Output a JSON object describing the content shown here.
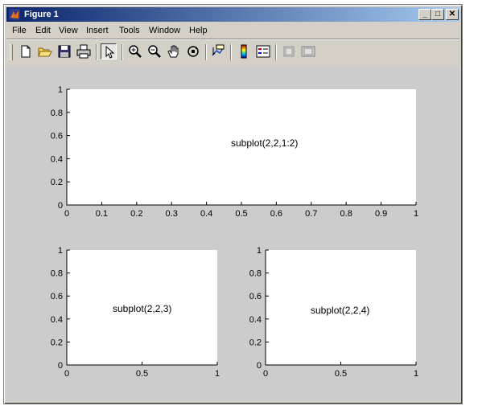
{
  "window": {
    "title": "Figure 1"
  },
  "title_buttons": {
    "minimize": "_",
    "maximize": "□",
    "close": "✕"
  },
  "menu": [
    "File",
    "Edit",
    "View",
    "Insert",
    "Tools",
    "Window",
    "Help"
  ],
  "toolbar": {
    "buttons": [
      "new-file",
      "open-folder",
      "save",
      "print",
      "select-arrow",
      "zoom-in",
      "zoom-out",
      "pan-hand",
      "rotate-3d",
      "data-cursor",
      "colorbar",
      "legend",
      "hide-plot-tools",
      "show-plot-tools"
    ]
  },
  "axes": [
    {
      "label": "subplot(2,2,1:2)",
      "xticks": [
        "0",
        "0.1",
        "0.2",
        "0.3",
        "0.4",
        "0.5",
        "0.6",
        "0.7",
        "0.8",
        "0.9",
        "1"
      ],
      "yticks": [
        "0",
        "0.2",
        "0.4",
        "0.6",
        "0.8",
        "1"
      ]
    },
    {
      "label": "subplot(2,2,3)",
      "xticks": [
        "0",
        "0.5",
        "1"
      ],
      "yticks": [
        "0",
        "0.2",
        "0.4",
        "0.6",
        "0.8",
        "1"
      ]
    },
    {
      "label": "subplot(2,2,4)",
      "xticks": [
        "0",
        "0.5",
        "1"
      ],
      "yticks": [
        "0",
        "0.2",
        "0.4",
        "0.6",
        "0.8",
        "1"
      ]
    }
  ],
  "colors": {
    "figure_bg": "#cccccc",
    "axes_bg": "#ffffff",
    "title_start": "#0a246a",
    "title_end": "#a6caf0"
  }
}
